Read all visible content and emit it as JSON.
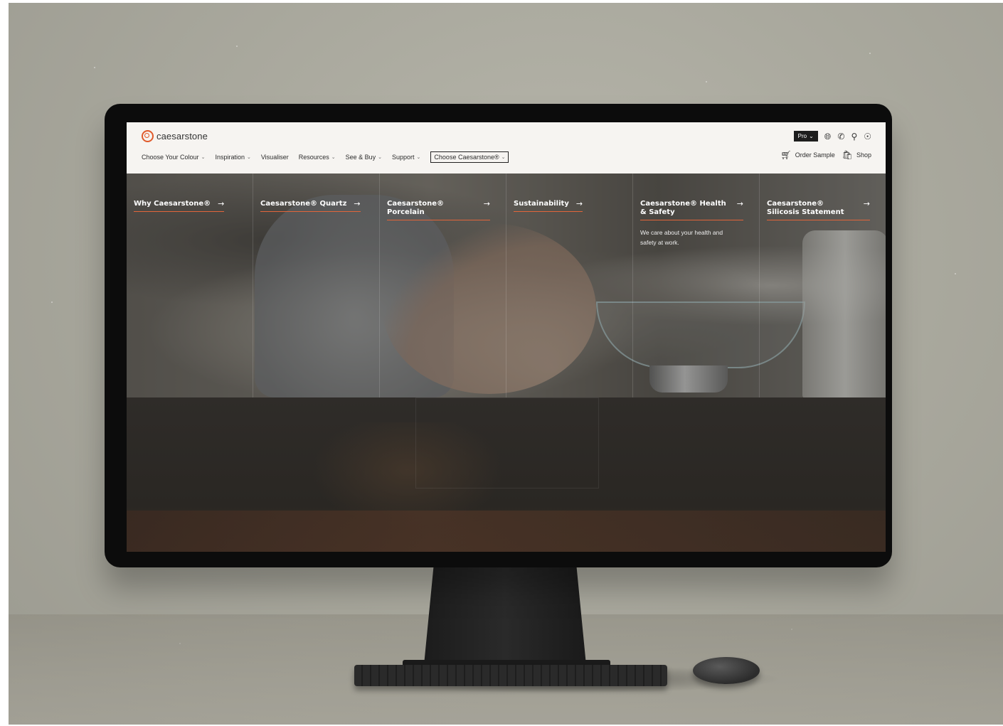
{
  "brand": {
    "name": "caesarstone",
    "accent": "#e05a2b"
  },
  "topbar": {
    "pro_label": "Pro",
    "pro_caret": "⌄",
    "icons": [
      "globe-icon",
      "phone-icon",
      "search-icon",
      "accessibility-icon"
    ]
  },
  "nav": {
    "items": [
      {
        "label": "Choose Your Colour",
        "has_caret": true
      },
      {
        "label": "Inspiration",
        "has_caret": true
      },
      {
        "label": "Visualiser",
        "has_caret": false
      },
      {
        "label": "Resources",
        "has_caret": true
      },
      {
        "label": "See & Buy",
        "has_caret": true
      },
      {
        "label": "Support",
        "has_caret": true
      },
      {
        "label": "Choose Caesarstone®",
        "has_caret": true,
        "active": true
      }
    ],
    "caret_glyph": "⌄",
    "order_sample": "Order Sample",
    "shop": "Shop"
  },
  "megamenu": {
    "arrow": "→",
    "columns": [
      {
        "title": "Why Caesarstone®",
        "desc": ""
      },
      {
        "title": "Caesarstone® Quartz",
        "desc": ""
      },
      {
        "title": "Caesarstone® Porcelain",
        "desc": ""
      },
      {
        "title": "Sustainability",
        "desc": ""
      },
      {
        "title": "Caesarstone® Health & Safety",
        "desc": "We care about your health and safety at work."
      },
      {
        "title": "Caesarstone® Silicosis Statement",
        "desc": ""
      }
    ]
  }
}
